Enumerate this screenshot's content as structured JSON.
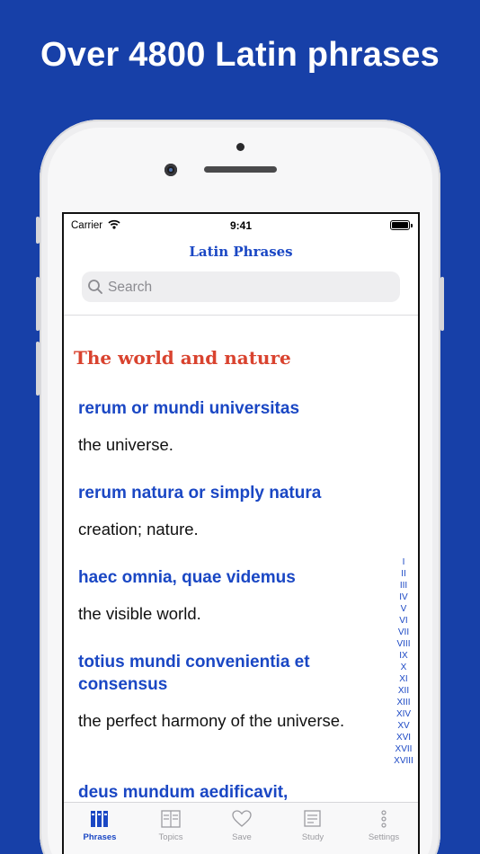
{
  "headline": "Over 4800 Latin phrases",
  "status": {
    "carrier": "Carrier",
    "time": "9:41"
  },
  "nav": {
    "title": "Latin Phrases"
  },
  "search": {
    "placeholder": "Search"
  },
  "section": {
    "title": "The world and nature"
  },
  "entries": [
    {
      "latin": "rerum or mundi universitas",
      "meaning": "the universe."
    },
    {
      "latin": "rerum natura or simply natura",
      "meaning": "creation; nature."
    },
    {
      "latin": "haec omnia, quae videmus",
      "meaning": "the visible world."
    },
    {
      "latin": "totius mundi convenientia et consensus",
      "meaning": "the perfect harmony of the universe."
    },
    {
      "latin": "deus mundum aedificavit,",
      "meaning": ""
    }
  ],
  "index": [
    "I",
    "II",
    "III",
    "IV",
    "V",
    "VI",
    "VII",
    "VIII",
    "IX",
    "X",
    "XI",
    "XII",
    "XIII",
    "XIV",
    "XV",
    "XVI",
    "XVII",
    "XVIII"
  ],
  "tabs": [
    {
      "label": "Phrases",
      "icon": "books-icon",
      "active": true
    },
    {
      "label": "Topics",
      "icon": "topics-icon",
      "active": false
    },
    {
      "label": "Save",
      "icon": "heart-icon",
      "active": false
    },
    {
      "label": "Study",
      "icon": "study-icon",
      "active": false
    },
    {
      "label": "Settings",
      "icon": "more-icon",
      "active": false
    }
  ],
  "colors": {
    "background": "#1740a8",
    "accent": "#1a47c4",
    "section_title": "#d9432f"
  }
}
